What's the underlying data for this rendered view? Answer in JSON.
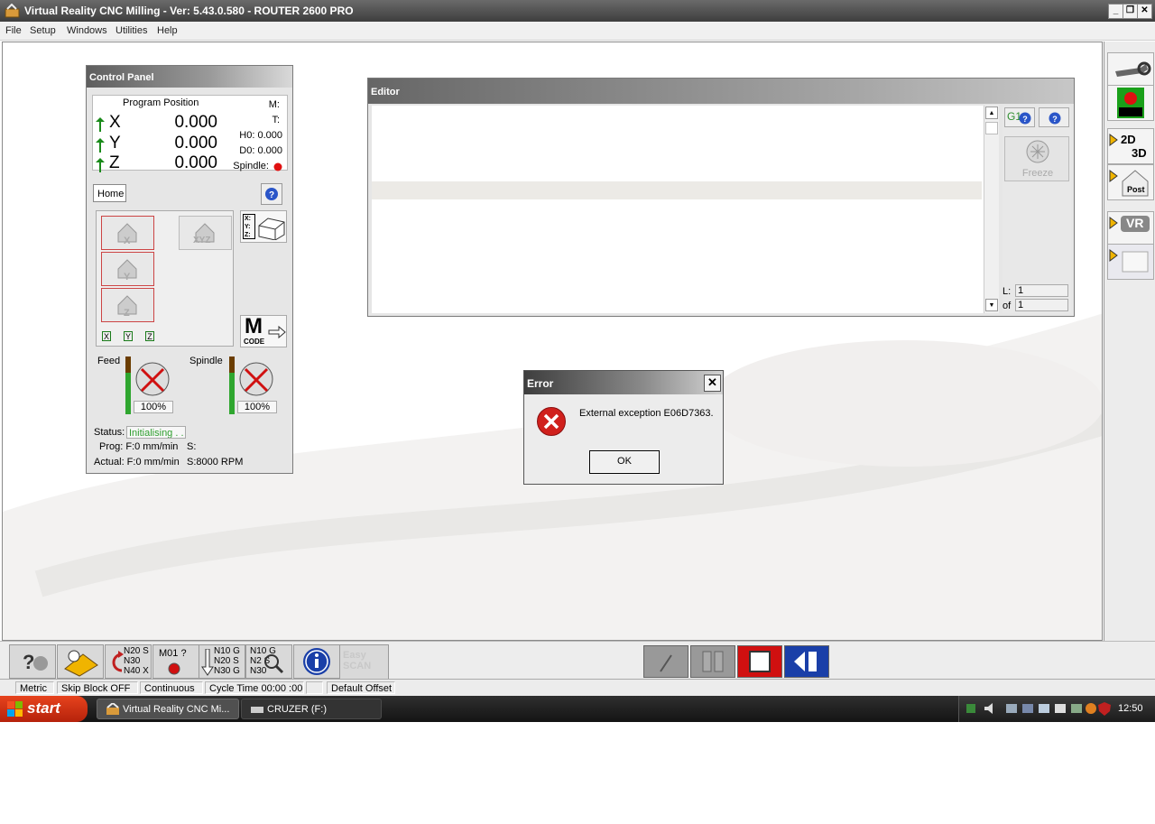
{
  "window": {
    "title": "Virtual Reality CNC Milling  -  Ver: 5.43.0.580 - ROUTER 2600 PRO",
    "minimize": "_",
    "restore": "❐",
    "close": "✕"
  },
  "menu": [
    "File",
    "Setup",
    "Windows",
    "Utilities",
    "Help"
  ],
  "control_panel": {
    "title": "Control Panel",
    "program_position": "Program Position",
    "axes": [
      {
        "name": "X",
        "value": "0.000"
      },
      {
        "name": "Y",
        "value": "0.000"
      },
      {
        "name": "Z",
        "value": "0.000"
      }
    ],
    "m": "M:",
    "t": "T:",
    "h0": "H0: 0.000",
    "d0": "D0: 0.000",
    "spindle": "Spindle:",
    "home_tab": "Home",
    "help": "?",
    "home_labels": {
      "x": "X",
      "y": "Y",
      "z": "Z",
      "xyz": "XYZ"
    },
    "mini_xyz": [
      "X",
      "Y",
      "Z"
    ],
    "mcode_label": "M",
    "mcode_sub": "CODE",
    "xyz_box": [
      "X:",
      "Y:",
      "Z:"
    ],
    "feed": "Feed",
    "spindle_label": "Spindle",
    "feed_pct": "100%",
    "spindle_pct": "100%",
    "status_label": "Status:",
    "status_value": "Initialising . . .",
    "prog": "Prog:  F:0 mm/min",
    "prog_s": "S:",
    "actual": "Actual:  F:0 mm/min",
    "actual_s": "S:8000 RPM",
    "feed_level": 0.72,
    "spindle_level": 0.72
  },
  "editor": {
    "title": "Editor",
    "g1": "G1",
    "freeze": "Freeze",
    "line_label": "L:",
    "line_value": "1",
    "of_label": "of",
    "of_value": "1"
  },
  "right_toolbar": {
    "twod": "2D",
    "threed": "3D",
    "post": "Post",
    "vr": "VR"
  },
  "bottom_toolbar": {
    "m01": "M01 ?",
    "n_codes": [
      "N20 S",
      "N30",
      "N40 X"
    ],
    "n_codes2": [
      "N10 G",
      "N20 S",
      "N30 G"
    ],
    "n_codes3": [
      "N10 G",
      "N2 S",
      "N30"
    ],
    "easyscan": [
      "Easy",
      "SCAN"
    ]
  },
  "status_bar": [
    "Metric",
    "Skip Block OFF",
    "Continuous",
    "Cycle Time 00:00 :00",
    "",
    "Default Offset"
  ],
  "taskbar": {
    "start": "start",
    "tasks": [
      "Virtual Reality CNC Mi...",
      "CRUZER (F:)"
    ],
    "clock": "12:50"
  },
  "dialog": {
    "title": "Error",
    "close": "✕",
    "message": "External exception E06D7363.",
    "ok": "OK"
  },
  "colors": {
    "status_green": "#2e9e2e",
    "error_red": "#d0201c",
    "stop_red": "#d01010",
    "blue": "#1a3fa8"
  }
}
